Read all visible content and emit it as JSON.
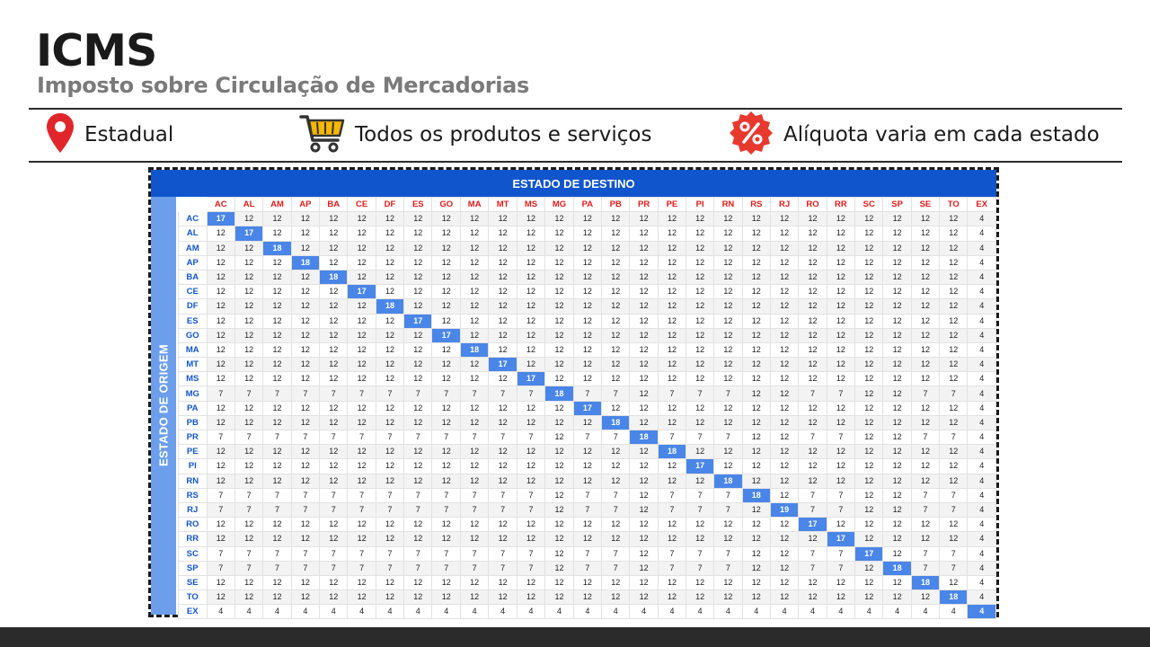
{
  "header": {
    "title": "ICMS",
    "subtitle": "Imposto sobre Circulação de Mercadorias"
  },
  "info_items": [
    {
      "icon": "map-pin-icon",
      "label": "Estadual",
      "color": "#e0262b"
    },
    {
      "icon": "shopping-cart-icon",
      "label": "Todos os produtos e serviços",
      "color": "#f5b800"
    },
    {
      "icon": "percent-badge-icon",
      "label": "Alíquota varia em cada estado",
      "color": "#e8392f"
    }
  ],
  "colors": {
    "header_blue": "#1155cc",
    "side_blue": "#6d9eeb",
    "diagonal_blue": "#4a86e8",
    "column_header_red": "#e21b1b",
    "row_header_blue": "#1155cc"
  },
  "table": {
    "destination_header": "ESTADO DE DESTINO",
    "origin_header": "ESTADO DE ORIGEM",
    "columns": [
      "AC",
      "AL",
      "AM",
      "AP",
      "BA",
      "CE",
      "DF",
      "ES",
      "GO",
      "MA",
      "MT",
      "MS",
      "MG",
      "PA",
      "PB",
      "PR",
      "PE",
      "PI",
      "RN",
      "RS",
      "RJ",
      "RO",
      "RR",
      "SC",
      "SP",
      "SE",
      "TO",
      "EX"
    ],
    "rows": [
      {
        "state": "AC",
        "values": [
          17,
          12,
          12,
          12,
          12,
          12,
          12,
          12,
          12,
          12,
          12,
          12,
          12,
          12,
          12,
          12,
          12,
          12,
          12,
          12,
          12,
          12,
          12,
          12,
          12,
          12,
          12,
          4
        ]
      },
      {
        "state": "AL",
        "values": [
          12,
          17,
          12,
          12,
          12,
          12,
          12,
          12,
          12,
          12,
          12,
          12,
          12,
          12,
          12,
          12,
          12,
          12,
          12,
          12,
          12,
          12,
          12,
          12,
          12,
          12,
          12,
          4
        ]
      },
      {
        "state": "AM",
        "values": [
          12,
          12,
          18,
          12,
          12,
          12,
          12,
          12,
          12,
          12,
          12,
          12,
          12,
          12,
          12,
          12,
          12,
          12,
          12,
          12,
          12,
          12,
          12,
          12,
          12,
          12,
          12,
          4
        ]
      },
      {
        "state": "AP",
        "values": [
          12,
          12,
          12,
          18,
          12,
          12,
          12,
          12,
          12,
          12,
          12,
          12,
          12,
          12,
          12,
          12,
          12,
          12,
          12,
          12,
          12,
          12,
          12,
          12,
          12,
          12,
          12,
          4
        ]
      },
      {
        "state": "BA",
        "values": [
          12,
          12,
          12,
          12,
          18,
          12,
          12,
          12,
          12,
          12,
          12,
          12,
          12,
          12,
          12,
          12,
          12,
          12,
          12,
          12,
          12,
          12,
          12,
          12,
          12,
          12,
          12,
          4
        ]
      },
      {
        "state": "CE",
        "values": [
          12,
          12,
          12,
          12,
          12,
          17,
          12,
          12,
          12,
          12,
          12,
          12,
          12,
          12,
          12,
          12,
          12,
          12,
          12,
          12,
          12,
          12,
          12,
          12,
          12,
          12,
          12,
          4
        ]
      },
      {
        "state": "DF",
        "values": [
          12,
          12,
          12,
          12,
          12,
          12,
          18,
          12,
          12,
          12,
          12,
          12,
          12,
          12,
          12,
          12,
          12,
          12,
          12,
          12,
          12,
          12,
          12,
          12,
          12,
          12,
          12,
          4
        ]
      },
      {
        "state": "ES",
        "values": [
          12,
          12,
          12,
          12,
          12,
          12,
          12,
          17,
          12,
          12,
          12,
          12,
          12,
          12,
          12,
          12,
          12,
          12,
          12,
          12,
          12,
          12,
          12,
          12,
          12,
          12,
          12,
          4
        ]
      },
      {
        "state": "GO",
        "values": [
          12,
          12,
          12,
          12,
          12,
          12,
          12,
          12,
          17,
          12,
          12,
          12,
          12,
          12,
          12,
          12,
          12,
          12,
          12,
          12,
          12,
          12,
          12,
          12,
          12,
          12,
          12,
          4
        ]
      },
      {
        "state": "MA",
        "values": [
          12,
          12,
          12,
          12,
          12,
          12,
          12,
          12,
          12,
          18,
          12,
          12,
          12,
          12,
          12,
          12,
          12,
          12,
          12,
          12,
          12,
          12,
          12,
          12,
          12,
          12,
          12,
          4
        ]
      },
      {
        "state": "MT",
        "values": [
          12,
          12,
          12,
          12,
          12,
          12,
          12,
          12,
          12,
          12,
          17,
          12,
          12,
          12,
          12,
          12,
          12,
          12,
          12,
          12,
          12,
          12,
          12,
          12,
          12,
          12,
          12,
          4
        ]
      },
      {
        "state": "MS",
        "values": [
          12,
          12,
          12,
          12,
          12,
          12,
          12,
          12,
          12,
          12,
          12,
          17,
          12,
          12,
          12,
          12,
          12,
          12,
          12,
          12,
          12,
          12,
          12,
          12,
          12,
          12,
          12,
          4
        ]
      },
      {
        "state": "MG",
        "values": [
          7,
          7,
          7,
          7,
          7,
          7,
          7,
          7,
          7,
          7,
          7,
          7,
          18,
          7,
          7,
          12,
          7,
          7,
          7,
          12,
          12,
          7,
          7,
          12,
          12,
          7,
          7,
          4
        ]
      },
      {
        "state": "PA",
        "values": [
          12,
          12,
          12,
          12,
          12,
          12,
          12,
          12,
          12,
          12,
          12,
          12,
          12,
          17,
          12,
          12,
          12,
          12,
          12,
          12,
          12,
          12,
          12,
          12,
          12,
          12,
          12,
          4
        ]
      },
      {
        "state": "PB",
        "values": [
          12,
          12,
          12,
          12,
          12,
          12,
          12,
          12,
          12,
          12,
          12,
          12,
          12,
          12,
          18,
          12,
          12,
          12,
          12,
          12,
          12,
          12,
          12,
          12,
          12,
          12,
          12,
          4
        ]
      },
      {
        "state": "PR",
        "values": [
          7,
          7,
          7,
          7,
          7,
          7,
          7,
          7,
          7,
          7,
          7,
          7,
          12,
          7,
          7,
          18,
          7,
          7,
          7,
          12,
          12,
          7,
          7,
          12,
          12,
          7,
          7,
          4
        ]
      },
      {
        "state": "PE",
        "values": [
          12,
          12,
          12,
          12,
          12,
          12,
          12,
          12,
          12,
          12,
          12,
          12,
          12,
          12,
          12,
          12,
          18,
          12,
          12,
          12,
          12,
          12,
          12,
          12,
          12,
          12,
          12,
          4
        ]
      },
      {
        "state": "PI",
        "values": [
          12,
          12,
          12,
          12,
          12,
          12,
          12,
          12,
          12,
          12,
          12,
          12,
          12,
          12,
          12,
          12,
          12,
          17,
          12,
          12,
          12,
          12,
          12,
          12,
          12,
          12,
          12,
          4
        ]
      },
      {
        "state": "RN",
        "values": [
          12,
          12,
          12,
          12,
          12,
          12,
          12,
          12,
          12,
          12,
          12,
          12,
          12,
          12,
          12,
          12,
          12,
          12,
          18,
          12,
          12,
          12,
          12,
          12,
          12,
          12,
          12,
          4
        ]
      },
      {
        "state": "RS",
        "values": [
          7,
          7,
          7,
          7,
          7,
          7,
          7,
          7,
          7,
          7,
          7,
          7,
          12,
          7,
          7,
          12,
          7,
          7,
          7,
          18,
          12,
          7,
          7,
          12,
          12,
          7,
          7,
          4
        ]
      },
      {
        "state": "RJ",
        "values": [
          7,
          7,
          7,
          7,
          7,
          7,
          7,
          7,
          7,
          7,
          7,
          7,
          12,
          7,
          7,
          12,
          7,
          7,
          7,
          12,
          19,
          7,
          7,
          12,
          12,
          7,
          7,
          4
        ]
      },
      {
        "state": "RO",
        "values": [
          12,
          12,
          12,
          12,
          12,
          12,
          12,
          12,
          12,
          12,
          12,
          12,
          12,
          12,
          12,
          12,
          12,
          12,
          12,
          12,
          12,
          17,
          12,
          12,
          12,
          12,
          12,
          4
        ]
      },
      {
        "state": "RR",
        "values": [
          12,
          12,
          12,
          12,
          12,
          12,
          12,
          12,
          12,
          12,
          12,
          12,
          12,
          12,
          12,
          12,
          12,
          12,
          12,
          12,
          12,
          12,
          17,
          12,
          12,
          12,
          12,
          4
        ]
      },
      {
        "state": "SC",
        "values": [
          7,
          7,
          7,
          7,
          7,
          7,
          7,
          7,
          7,
          7,
          7,
          7,
          12,
          7,
          7,
          12,
          7,
          7,
          7,
          12,
          12,
          7,
          7,
          17,
          12,
          7,
          7,
          4
        ]
      },
      {
        "state": "SP",
        "values": [
          7,
          7,
          7,
          7,
          7,
          7,
          7,
          7,
          7,
          7,
          7,
          7,
          12,
          7,
          7,
          12,
          7,
          7,
          7,
          12,
          12,
          7,
          7,
          12,
          18,
          7,
          7,
          4
        ]
      },
      {
        "state": "SE",
        "values": [
          12,
          12,
          12,
          12,
          12,
          12,
          12,
          12,
          12,
          12,
          12,
          12,
          12,
          12,
          12,
          12,
          12,
          12,
          12,
          12,
          12,
          12,
          12,
          12,
          12,
          18,
          12,
          4
        ]
      },
      {
        "state": "TO",
        "values": [
          12,
          12,
          12,
          12,
          12,
          12,
          12,
          12,
          12,
          12,
          12,
          12,
          12,
          12,
          12,
          12,
          12,
          12,
          12,
          12,
          12,
          12,
          12,
          12,
          12,
          12,
          18,
          4
        ]
      },
      {
        "state": "EX",
        "values": [
          4,
          4,
          4,
          4,
          4,
          4,
          4,
          4,
          4,
          4,
          4,
          4,
          4,
          4,
          4,
          4,
          4,
          4,
          4,
          4,
          4,
          4,
          4,
          4,
          4,
          4,
          4,
          4
        ]
      }
    ]
  }
}
